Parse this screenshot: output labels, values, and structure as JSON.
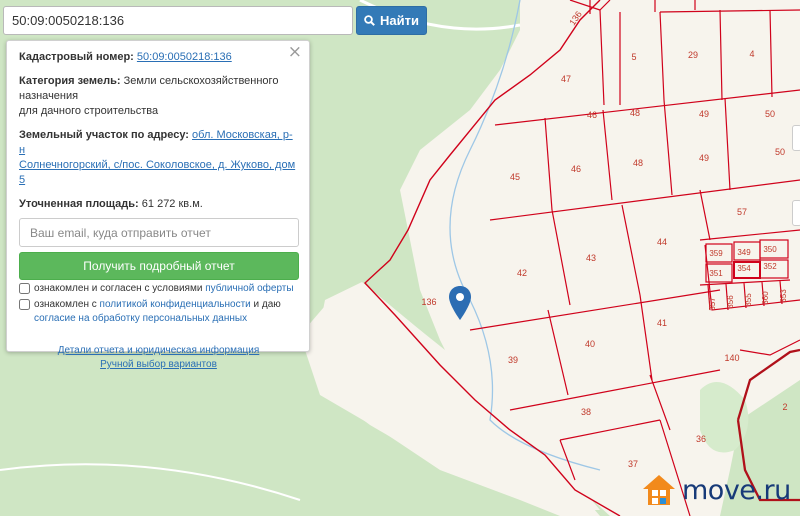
{
  "search": {
    "value": "50:09:0050218:136",
    "button_label": "Найти"
  },
  "panel": {
    "cadastral_label": "Кадастровый номер:",
    "cadastral_value": "50:09:0050218:136",
    "category_label": "Категория земель:",
    "category_value_line1": "Земли сельскохозяйственного",
    "category_value_line2": "назначения",
    "category_value_line3": "для дачного строительства",
    "address_label": "Земельный участок по адресу:",
    "address_value_line1": "обл. Московская, р-н",
    "address_value_line2": "Солнечногорский, с/пос. Соколовское, д. Жуково, дом 5",
    "area_label": "Уточненная площадь:",
    "area_value": "61 272 кв.м.",
    "email_placeholder": "Ваш email, куда отправить отчет",
    "report_button": "Получить подробный отчет",
    "consent1_text": "ознакомлен и согласен с условиями ",
    "consent1_link": "публичной оферты",
    "consent2_text_a": "ознакомлен с ",
    "consent2_link": "политикой конфиденциальности",
    "consent2_text_b": " и даю",
    "consent2_link2": "согласие на обработку персональных данных",
    "details_link": "Детали отчета и юридическая информация",
    "manual_link": "Ручной выбор вариантов",
    "close_symbol": "×"
  },
  "map": {
    "parcel_labels": [
      "136",
      "136",
      "47",
      "5",
      "29",
      "4",
      "46",
      "48",
      "49",
      "50",
      "45",
      "46",
      "48",
      "49",
      "50",
      "57",
      "44",
      "42",
      "43",
      "359",
      "349",
      "350",
      "351",
      "354",
      "352",
      "357",
      "356",
      "355",
      "360",
      "353",
      "41",
      "39",
      "40",
      "140",
      "38",
      "36",
      "37",
      "2"
    ],
    "pin_icon": "map-marker-icon",
    "colors": {
      "forest": "#cfe6c4",
      "field": "#f6f3ec",
      "parcel_border": "#d0021b",
      "road": "#ffffff",
      "stream": "#9ec7e6"
    }
  },
  "brand": {
    "logo_text": "move.ru",
    "logo_icon": "house-icon"
  }
}
